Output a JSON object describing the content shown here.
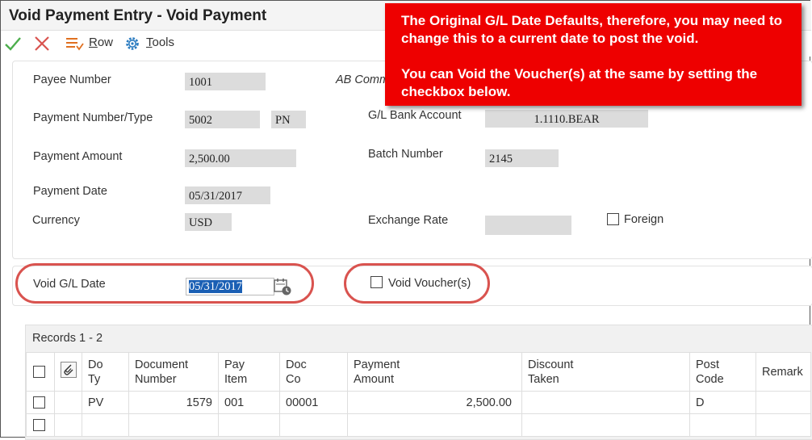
{
  "window": {
    "title": "Void Payment Entry - Void Payment"
  },
  "toolbar": {
    "ok_icon": "checkmark-icon",
    "cancel_icon": "x-icon",
    "row_icon": "row-menu-icon",
    "row_label_hotkey": "R",
    "row_label_rest": "ow",
    "tools_icon": "gear-icon",
    "tools_label_hotkey": "T",
    "tools_label_rest": "ools"
  },
  "form": {
    "payee_number_label": "Payee Number",
    "payee_number_value": "1001",
    "payee_name": "AB Comm",
    "payment_number_type_label": "Payment Number/Type",
    "payment_number_value": "5002",
    "payment_type_value": "PN",
    "gl_bank_account_label": "G/L Bank Account",
    "gl_bank_account_value": "1.1110.BEAR",
    "payment_amount_label": "Payment Amount",
    "payment_amount_value": "2,500.00",
    "batch_number_label": "Batch Number",
    "batch_number_value": "2145",
    "payment_date_label": "Payment Date",
    "payment_date_value": "05/31/2017",
    "currency_label": "Currency",
    "currency_value": "USD",
    "exchange_rate_label": "Exchange Rate",
    "exchange_rate_value": "",
    "foreign_label": "Foreign"
  },
  "void_section": {
    "void_gl_date_label": "Void G/L Date",
    "void_gl_date_value": "05/31/2017",
    "calendar_icon": "calendar-icon",
    "void_vouchers_label": "Void Voucher(s)"
  },
  "grid": {
    "records_label": "Records 1 - 2",
    "attachment_icon": "paperclip-icon",
    "columns": [
      {
        "line1": "Do",
        "line2": "Ty"
      },
      {
        "line1": "Document",
        "line2": "Number"
      },
      {
        "line1": "Pay",
        "line2": "Item"
      },
      {
        "line1": "Doc",
        "line2": "Co"
      },
      {
        "line1": "Payment",
        "line2": "Amount"
      },
      {
        "line1": "Discount",
        "line2": "Taken"
      },
      {
        "line1": "Post",
        "line2": "Code"
      },
      {
        "line1": "Remark",
        "line2": ""
      }
    ],
    "rows": [
      {
        "do_ty": "PV",
        "document_number": "1579",
        "pay_item": "001",
        "doc_co": "00001",
        "payment_amount": "2,500.00",
        "discount_taken": "",
        "post_code": "D",
        "remark": ""
      },
      {
        "do_ty": "",
        "document_number": "",
        "pay_item": "",
        "doc_co": "",
        "payment_amount": "",
        "discount_taken": "",
        "post_code": "",
        "remark": ""
      }
    ]
  },
  "callout": {
    "line1": "The Original G/L Date Defaults, therefore, you may need to change this to a current date to post the void.",
    "line2": "You can Void the Voucher(s) at the same by setting the checkbox below."
  },
  "colors": {
    "callout_bg": "#ee0000",
    "highlight_oval": "#d9534f",
    "selection": "#1a5fb4",
    "ok_green": "#4cae4c",
    "cancel_red": "#d9534f"
  }
}
